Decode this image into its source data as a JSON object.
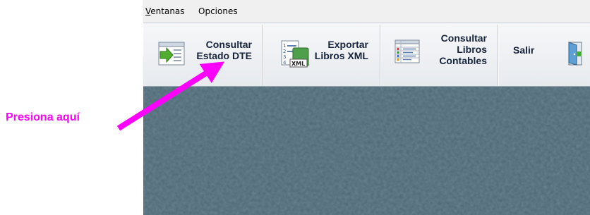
{
  "menubar": {
    "items": [
      {
        "label_rest": "entanas",
        "mnemonic": "V"
      },
      {
        "label": "Opciones"
      }
    ]
  },
  "toolbar": {
    "buttons": [
      {
        "label_line1": "Consultar",
        "label_line2": "Estado DTE",
        "icon": "arrow-document-icon"
      },
      {
        "label_line1": "Exportar",
        "label_line2": "Libros XML",
        "icon": "xml-list-icon"
      },
      {
        "label_line1": "Consultar",
        "label_line2": "Libros",
        "label_line3": "Contables",
        "icon": "spreadsheet-icon"
      },
      {
        "label": "Salir",
        "icon": "exit-door-icon"
      }
    ]
  },
  "annotation": {
    "text": "Presiona aquí",
    "color": "#ff00ff"
  },
  "colors": {
    "desktop": "#4e6673",
    "toolbar_text": "#15243a",
    "menubar": "#f0f0f0"
  }
}
